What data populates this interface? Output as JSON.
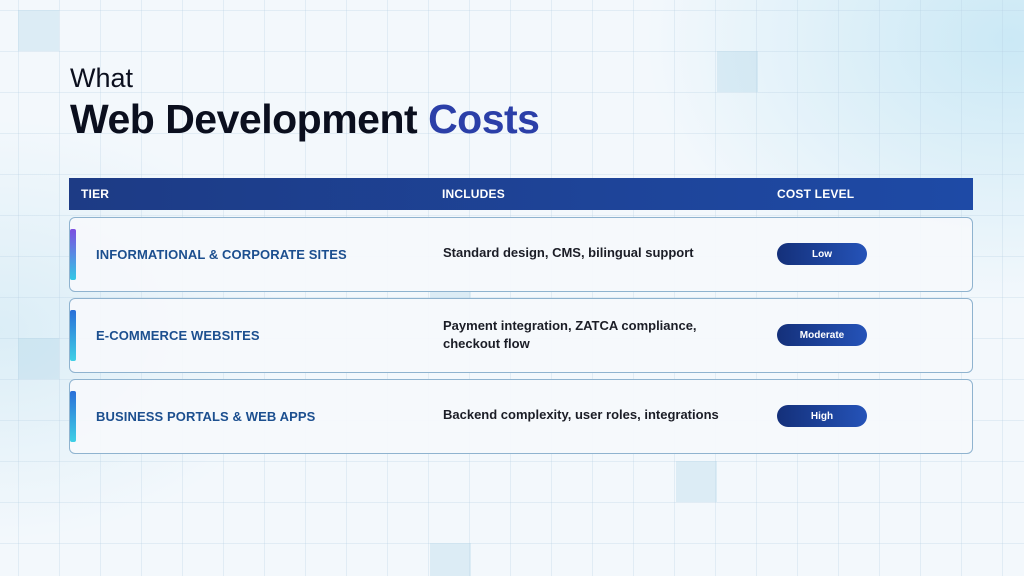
{
  "heading": {
    "kicker": "What",
    "title_main": "Web Development",
    "title_accent": "Costs"
  },
  "table": {
    "columns": [
      "TIER",
      "INCLUDES",
      "COST LEVEL"
    ],
    "rows": [
      {
        "tier": "INFORMATIONAL & CORPORATE SITES",
        "includes": "Standard design, CMS, bilingual support",
        "cost": "Low"
      },
      {
        "tier": "E-COMMERCE WEBSITES",
        "includes": "Payment integration, ZATCA compliance, checkout flow",
        "cost": "Moderate"
      },
      {
        "tier": "BUSINESS PORTALS & WEB APPS",
        "includes": "Backend complexity, user roles, integrations",
        "cost": "High"
      }
    ]
  },
  "colors": {
    "title_text": "#0b0f1e",
    "title_accent": "#2b3fa8",
    "header_bg": "#1d3b85",
    "tier_text": "#1c4f8f",
    "badge_bg": "#14307a"
  }
}
